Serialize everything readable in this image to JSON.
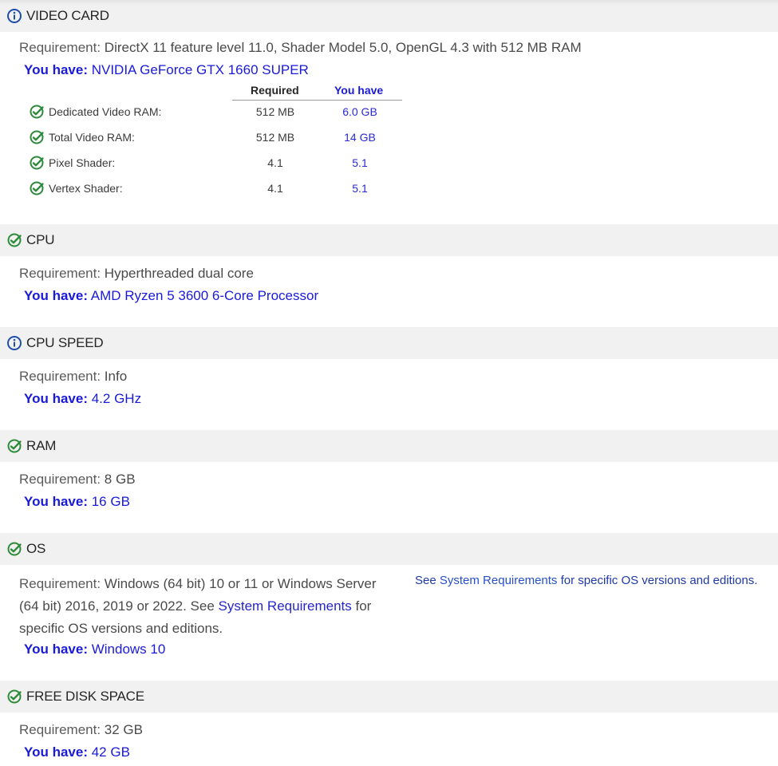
{
  "sections": {
    "video_card": {
      "title": "VIDEO CARD",
      "status_icon": "info-icon",
      "requirement_key": "Requirement:",
      "requirement_value": "DirectX 11 feature level 11.0, Shader Model 5.0, OpenGL 4.3 with 512 MB RAM",
      "have_key": "You have:",
      "have_value": "NVIDIA GeForce GTX 1660 SUPER",
      "table": {
        "headers": {
          "required": "Required",
          "you_have": "You have"
        },
        "rows": [
          {
            "label": "Dedicated Video RAM:",
            "required": "512 MB",
            "have": "6.0 GB"
          },
          {
            "label": "Total Video RAM:",
            "required": "512 MB",
            "have": "14 GB"
          },
          {
            "label": "Pixel Shader:",
            "required": "4.1",
            "have": "5.1"
          },
          {
            "label": "Vertex Shader:",
            "required": "4.1",
            "have": "5.1"
          }
        ]
      }
    },
    "cpu": {
      "title": "CPU",
      "status_icon": "check-circle-icon",
      "requirement_key": "Requirement:",
      "requirement_value": "Hyperthreaded dual core",
      "have_key": "You have:",
      "have_value": "AMD Ryzen 5 3600 6-Core Processor"
    },
    "cpu_speed": {
      "title": "CPU SPEED",
      "status_icon": "info-icon",
      "requirement_key": "Requirement:",
      "requirement_value": "Info",
      "have_key": "You have:",
      "have_value": "4.2 GHz"
    },
    "ram": {
      "title": "RAM",
      "status_icon": "check-circle-icon",
      "requirement_key": "Requirement:",
      "requirement_value": "8 GB",
      "have_key": "You have:",
      "have_value": "16 GB"
    },
    "os": {
      "title": "OS",
      "status_icon": "check-circle-icon",
      "requirement_key": "Requirement:",
      "requirement_value_1": "Windows (64 bit) 10 or 11 or Windows Server (64 bit) 2016, 2019 or 2022. See",
      "requirement_link": "System Requirements",
      "requirement_value_2": "for specific OS versions and editions.",
      "side_note_prefix": "See",
      "side_note_link": "System Requirements",
      "side_note_suffix": "for specific OS versions and editions.",
      "have_key": "You have:",
      "have_value": "Windows 10"
    },
    "disk": {
      "title": "FREE DISK SPACE",
      "status_icon": "check-circle-icon",
      "requirement_key": "Requirement:",
      "requirement_value": "32 GB",
      "have_key": "You have:",
      "have_value": "42 GB"
    }
  },
  "colors": {
    "header_bg": "#f1f1f1",
    "check_green": "#2e8b3a",
    "info_blue": "#1f4fa8",
    "have_blue": "#1a1ad9"
  }
}
